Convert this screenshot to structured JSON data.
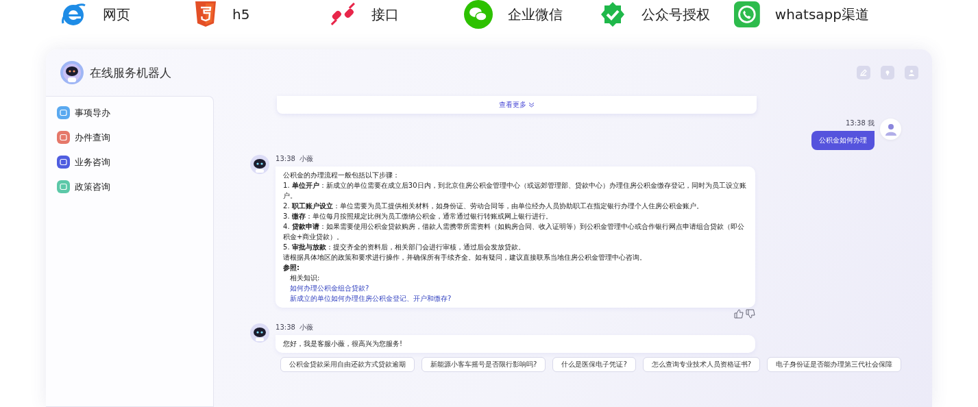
{
  "channels": [
    {
      "kind": "ie",
      "label": "网页"
    },
    {
      "kind": "html5",
      "label": "h5"
    },
    {
      "kind": "plug",
      "label": "接口"
    },
    {
      "kind": "wechat",
      "label": "企业微信"
    },
    {
      "kind": "verified",
      "label": "公众号授权"
    },
    {
      "kind": "whatsapp",
      "label": "whatsapp渠道"
    }
  ],
  "window": {
    "title": "在线服务机器人"
  },
  "sidebar": {
    "items": [
      {
        "label": "事项导办",
        "color": "#5aa9f0"
      },
      {
        "label": "办件查询",
        "color": "#e5786a"
      },
      {
        "label": "业务咨询",
        "color": "#4f5de0"
      },
      {
        "label": "政策咨询",
        "color": "#5cc8a8"
      }
    ]
  },
  "messages": [
    {
      "kind": "collapsed",
      "more": "查看更多"
    },
    {
      "kind": "user",
      "time": "13:38",
      "sender": "我",
      "text": "公积金如何办理"
    },
    {
      "kind": "bot",
      "time": "13:38",
      "sender": "小薇",
      "lines": [
        "公积金的办理流程一般包括以下步骤：",
        "1. **单位开户**：新成立的单位需要在成立后30日内，到北京住房公积金管理中心（或远郊管理部、贷款中心）办理住房公积金缴存登记，同时为员工设立账户。",
        "2. **职工账户设立**：单位需要为员工提供相关材料，如身份证、劳动合同等，由单位经办人员协助职工在指定银行办理个人住房公积金账户。",
        "3. **缴存**：单位每月按照规定比例为员工缴纳公积金，通常通过银行转账或网上银行进行。",
        "4. **贷款申请**：如果需要使用公积金贷款购房，借款人需携带所需资料（如购房合同、收入证明等）到公积金管理中心或合作银行网点申请组合贷款（即公积金+商业贷款）。",
        "5. **审批与放款**：提交齐全的资料后，相关部门会进行审核，通过后会发放贷款。",
        "请根据具体地区的政策和要求进行操作，并确保所有手续齐全。如有疑问，建议直接联系当地住房公积金管理中心咨询。"
      ],
      "ref_title": "参照:",
      "ref_label": "相关知识:",
      "links": [
        "如何办理公积金组合贷款?",
        "新成立的单位如何办理住房公积金登记、开户和缴存?"
      ],
      "feedback": true
    },
    {
      "kind": "bot",
      "time": "13:38",
      "sender": "小薇",
      "lines": [
        "您好，我是客服小薇，很高兴为您服务!"
      ],
      "feedback": false
    }
  ],
  "suggestions": [
    "公积金贷款采用自由还款方式贷款逾期",
    "新能源小客车摇号是否限行影响吗?",
    "什么是医保电子凭证?",
    "怎么查询专业技术人员资格证书?",
    "电子身份证是否能办理第三代社会保障"
  ]
}
